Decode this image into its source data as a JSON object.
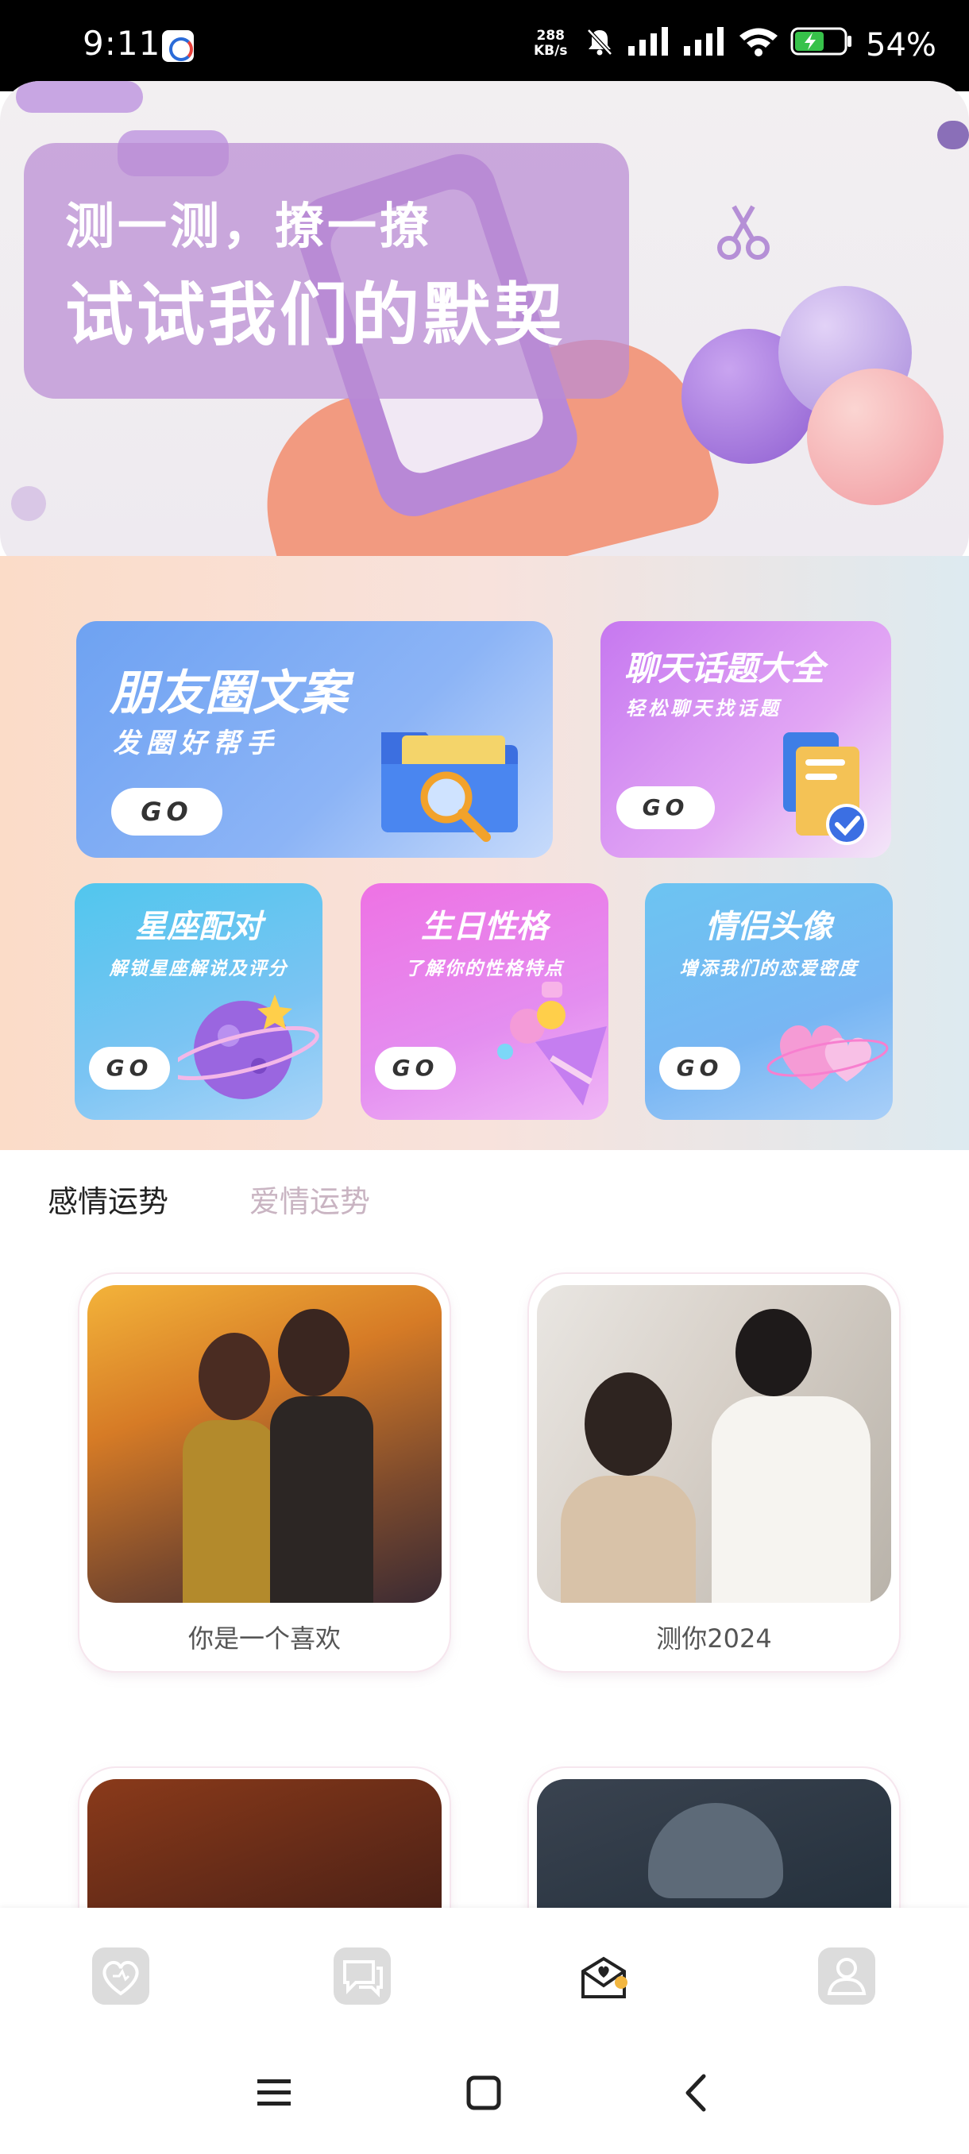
{
  "status_bar": {
    "time": "9:11",
    "speed_value": "288",
    "speed_unit": "KB/s",
    "battery": "54%"
  },
  "hero": {
    "line1": "测一测，撩一撩",
    "line2": "试试我们的默契"
  },
  "features": [
    {
      "title": "朋友圈文案",
      "subtitle": "发圈好帮手",
      "button": "GO"
    },
    {
      "title": "聊天话题大全",
      "subtitle": "轻松聊天找话题",
      "button": "GO"
    },
    {
      "title": "星座配对",
      "subtitle": "解锁星座解说及评分",
      "button": "GO"
    },
    {
      "title": "生日性格",
      "subtitle": "了解你的性格特点",
      "button": "GO"
    },
    {
      "title": "情侣头像",
      "subtitle": "增添我们的恋爱密度",
      "button": "GO"
    }
  ],
  "tabs": [
    {
      "label": "感情运势",
      "active": true
    },
    {
      "label": "爱情运势",
      "active": false
    }
  ],
  "items": [
    {
      "label": "你是一个喜欢"
    },
    {
      "label": "测你2024"
    },
    {
      "label": ""
    },
    {
      "label": ""
    }
  ],
  "bottom_nav": [
    {
      "icon": "heart-icon",
      "active": false
    },
    {
      "icon": "chat-icon",
      "active": false
    },
    {
      "icon": "love-letter-icon",
      "active": true
    },
    {
      "icon": "profile-icon",
      "active": false
    }
  ],
  "system_nav": [
    "menu-icon",
    "home-icon",
    "back-icon"
  ],
  "colors": {
    "accent_purple": "#b888d6",
    "tab_inactive": "#c9b4c2",
    "nav_active_dot": "#f2b640"
  }
}
